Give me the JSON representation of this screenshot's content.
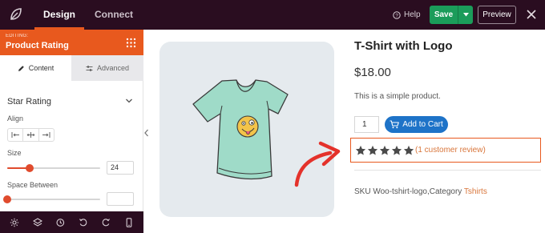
{
  "topbar": {
    "tabs": [
      "Design",
      "Connect"
    ],
    "help_label": "Help",
    "save_label": "Save",
    "preview_label": "Preview"
  },
  "sidebar": {
    "editing_label": "EDITING:",
    "module_title": "Product Rating",
    "tabs": [
      "Content",
      "Advanced"
    ],
    "section_title": "Star Rating",
    "align_label": "Align",
    "size_label": "Size",
    "size_value": "24",
    "size_fraction": 0.24,
    "space_label": "Space Between",
    "space_value": "",
    "space_fraction": 0.0
  },
  "product": {
    "title": "T-Shirt with Logo",
    "price": "$18.00",
    "description": "This is a simple product.",
    "quantity": "1",
    "add_to_cart_label": "Add to Cart",
    "rating": 5,
    "review_link": "(1 customer review)",
    "sku_text": "SKU Woo-tshirt-logo,Category ",
    "category_link": "Tshirts"
  },
  "colors": {
    "topbar_bg": "#2a0d20",
    "accent_orange": "#e8591e",
    "save_green": "#1b9c5a",
    "cart_blue": "#1e73c8",
    "link_orange": "#d9763b",
    "annotation_red": "#e4322b"
  },
  "icons": {
    "logo": "seedprod-leaf-icon",
    "help": "help-circle-icon",
    "close": "close-icon",
    "grid": "grid-dots-icon",
    "content_tab": "pencil-icon",
    "advanced_tab": "sliders-icon",
    "cart": "cart-icon",
    "bottom": [
      "settings-icon",
      "layers-icon",
      "history-icon",
      "undo-icon",
      "redo-icon",
      "mobile-icon"
    ]
  }
}
